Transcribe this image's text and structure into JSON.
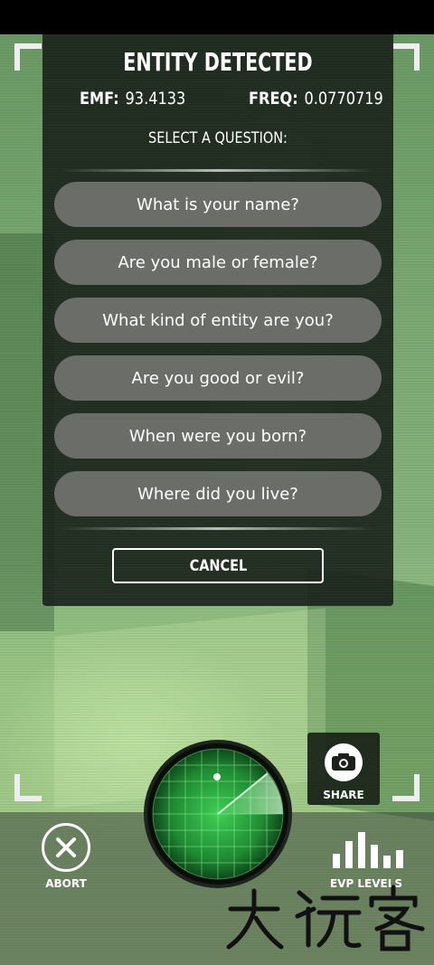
{
  "dialog": {
    "title": "ENTITY DETECTED",
    "emf_label": "EMF:",
    "emf_value": "93.4133",
    "freq_label": "FREQ:",
    "freq_value": "0.0770719",
    "prompt": "SELECT A QUESTION:",
    "questions": [
      "What is your name?",
      "Are you male or female?",
      "What kind of entity are you?",
      "Are you good or evil?",
      "When were you born?",
      "Where did you live?"
    ],
    "cancel_label": "CANCEL"
  },
  "controls": {
    "abort_label": "ABORT",
    "share_label": "SHARE",
    "evp_label": "EVP LEVELS"
  },
  "icons": {
    "abort": "close-icon",
    "share": "camera-icon",
    "evp": "bar-levels-icon",
    "radar": "radar-icon"
  },
  "colors": {
    "dialog_bg": "#182018",
    "button_bg": "#6b6d69",
    "radar_green": "#2fae3f"
  },
  "watermark": "大玩客"
}
